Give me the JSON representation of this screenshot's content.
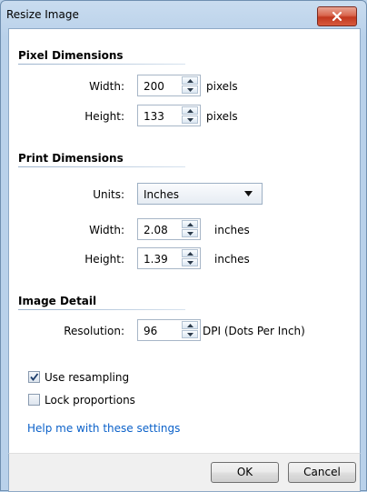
{
  "window": {
    "title": "Resize Image"
  },
  "pixel_dimensions": {
    "title": "Pixel Dimensions",
    "width_label": "Width:",
    "width_value": "200",
    "width_unit": "pixels",
    "height_label": "Height:",
    "height_value": "133",
    "height_unit": "pixels"
  },
  "print_dimensions": {
    "title": "Print Dimensions",
    "units_label": "Units:",
    "units_value": "Inches",
    "width_label": "Width:",
    "width_value": "2.08",
    "width_unit": "inches",
    "height_label": "Height:",
    "height_value": "1.39",
    "height_unit": "inches"
  },
  "image_detail": {
    "title": "Image Detail",
    "resolution_label": "Resolution:",
    "resolution_value": "96",
    "resolution_unit": "DPI (Dots Per Inch)"
  },
  "options": {
    "use_resampling_label": "Use resampling",
    "use_resampling_checked": true,
    "lock_proportions_label": "Lock proportions",
    "lock_proportions_checked": false
  },
  "help_link": "Help me with these settings",
  "buttons": {
    "ok": "OK",
    "cancel": "Cancel"
  },
  "colors": {
    "accent": "#0b61c9",
    "close_button": "#c2381f"
  }
}
